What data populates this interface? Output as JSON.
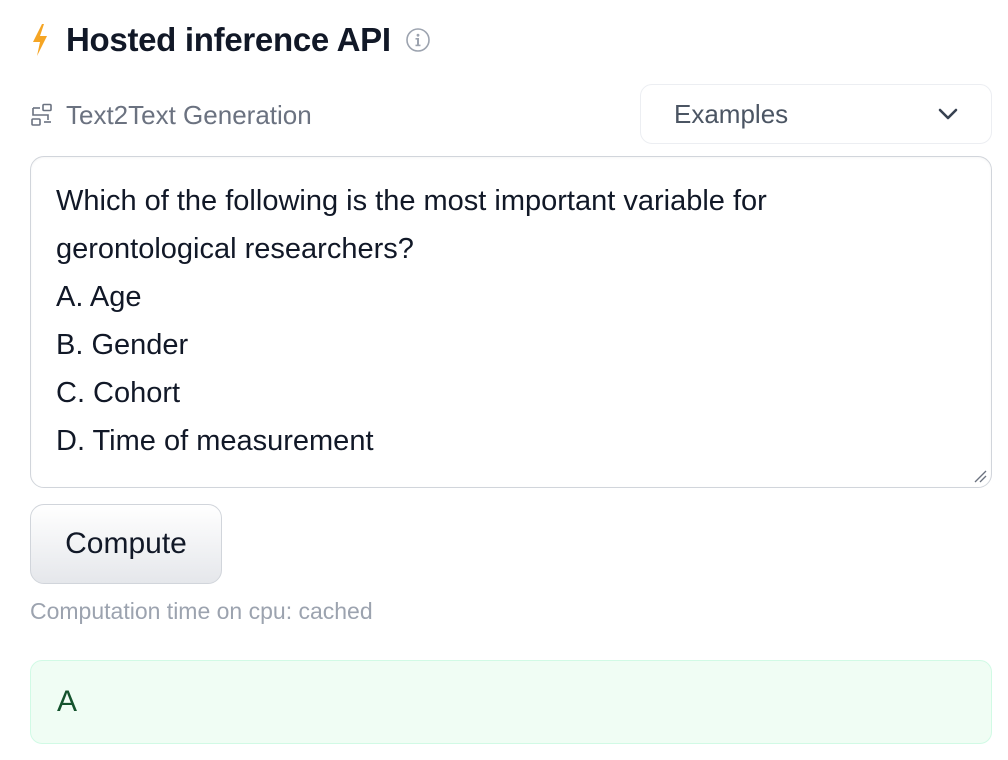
{
  "header": {
    "title": "Hosted inference API",
    "bolt_icon": "bolt-icon",
    "info_icon": "info-icon",
    "accent": "#f59e0b"
  },
  "task": {
    "icon": "text2text-icon",
    "label": "Text2Text Generation"
  },
  "examples": {
    "label": "Examples",
    "icon": "chevron-down-icon"
  },
  "input": {
    "value": "Which of the following is the most important variable for\ngerontological researchers?\nA. Age\nB. Gender\nC. Cohort\nD. Time of measurement"
  },
  "actions": {
    "compute_label": "Compute"
  },
  "status": {
    "timing": "Computation time on cpu: cached"
  },
  "output": {
    "text": "A",
    "bg_color": "#f0fdf4"
  }
}
